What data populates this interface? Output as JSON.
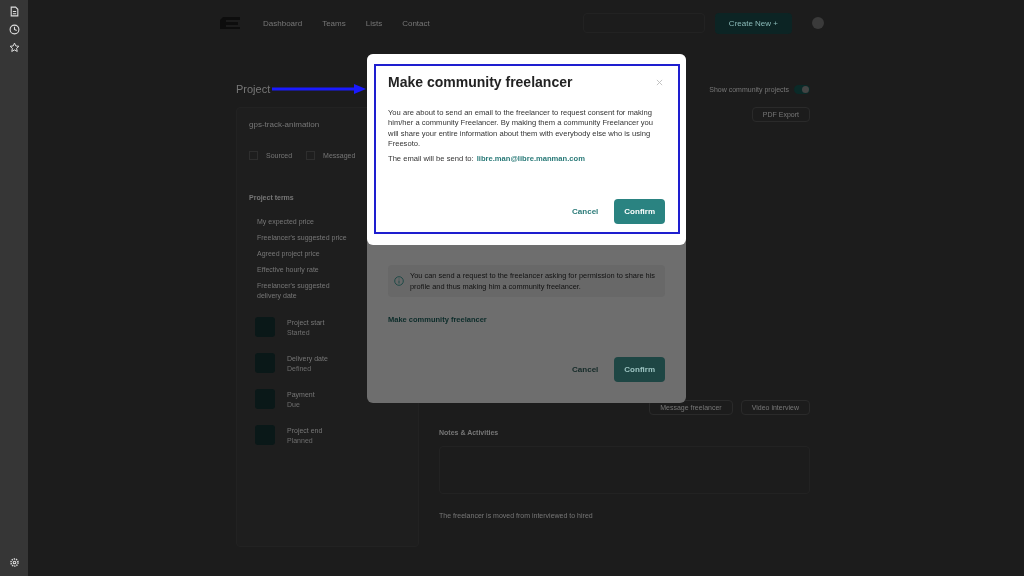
{
  "nav": {
    "links": [
      "Dashboard",
      "Teams",
      "Lists",
      "Contact"
    ],
    "create_button": "Create New +"
  },
  "page": {
    "title": "Project",
    "show_community": {
      "label": "Show community projects",
      "on": true
    },
    "project_name": "gps-track-animation",
    "statuses": [
      {
        "label": "Sourced",
        "checked": false
      },
      {
        "label": "Messaged",
        "checked": false
      }
    ],
    "pdf_export": "PDF Export",
    "terms_title": "Project terms",
    "terms": [
      "My expected price",
      "Freelancer's suggested price",
      "Agreed project price",
      "Effective hourly rate",
      "Freelancer's suggested delivery date"
    ],
    "milestones": [
      {
        "title": "Project start",
        "status": "Started"
      },
      {
        "title": "Delivery date",
        "status": "Defined"
      },
      {
        "title": "Payment",
        "status": "Due"
      },
      {
        "title": "Project end",
        "status": "Planned"
      }
    ],
    "actions": [
      "Message freelancer",
      "Video interview"
    ],
    "notes_title": "Notes & Activities",
    "log": "The freelancer is moved from interviewed to hired"
  },
  "back_dialog": {
    "info": "You can send a request to the freelancer asking  for permission to share his profile and thus making him a community freelancer.",
    "link": "Make community freelancer",
    "cancel": "Cancel",
    "confirm": "Confirm"
  },
  "dialog": {
    "title": "Make community freelancer",
    "body": "You are about to send an email to the freelancer to request consent for making him/her a community Freelancer. By making them a community Freelancer you will share your entire information about them with everybody else who is using Freesoto.",
    "email_label": "The email will be send to:",
    "email": "libre.man@libre.manman.com",
    "cancel": "Cancel",
    "confirm": "Confirm"
  }
}
